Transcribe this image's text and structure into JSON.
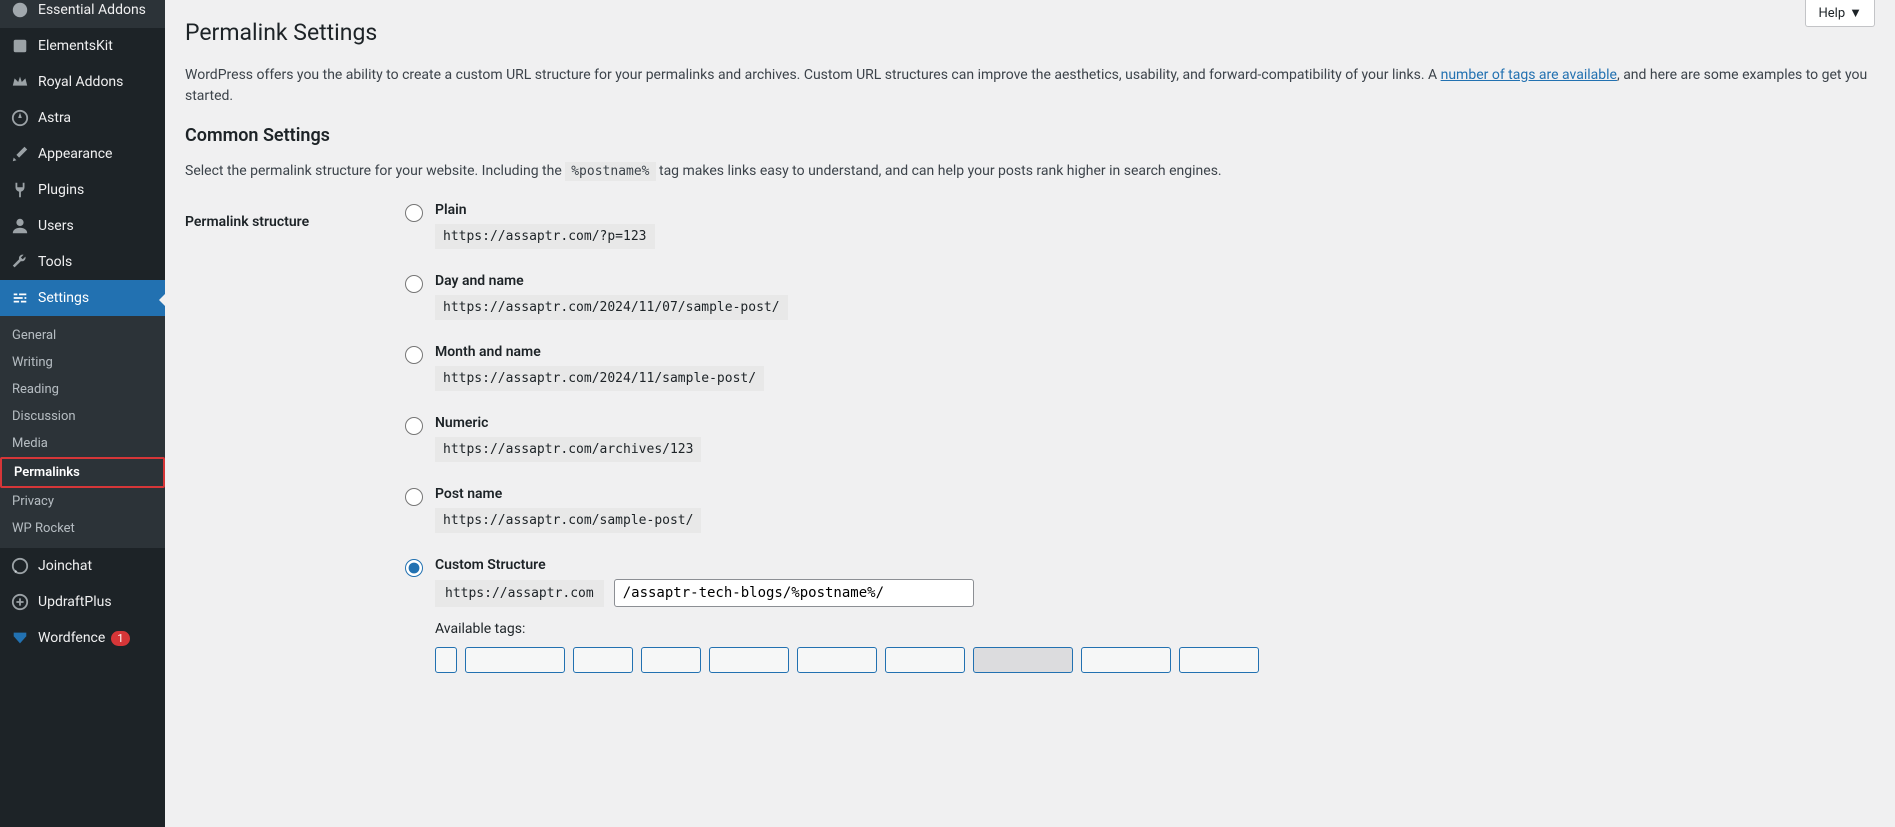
{
  "sidebar": {
    "items": [
      {
        "label": "Essential Addons",
        "icon": "plugin"
      },
      {
        "label": "ElementsKit",
        "icon": "kit"
      },
      {
        "label": "Royal Addons",
        "icon": "crown"
      },
      {
        "label": "Astra",
        "icon": "astra"
      },
      {
        "label": "Appearance",
        "icon": "brush"
      },
      {
        "label": "Plugins",
        "icon": "plug"
      },
      {
        "label": "Users",
        "icon": "user"
      },
      {
        "label": "Tools",
        "icon": "wrench"
      },
      {
        "label": "Settings",
        "icon": "sliders",
        "active": true
      }
    ],
    "submenu": [
      {
        "label": "General"
      },
      {
        "label": "Writing"
      },
      {
        "label": "Reading"
      },
      {
        "label": "Discussion"
      },
      {
        "label": "Media"
      },
      {
        "label": "Permalinks",
        "current": true
      },
      {
        "label": "Privacy"
      },
      {
        "label": "WP Rocket"
      }
    ],
    "post_items": [
      {
        "label": "Joinchat",
        "icon": "chat"
      },
      {
        "label": "UpdraftPlus",
        "icon": "updraft"
      },
      {
        "label": "Wordfence",
        "icon": "wordfence",
        "badge": "1"
      }
    ]
  },
  "help_label": "Help",
  "page_title": "Permalink Settings",
  "intro_text_1": "WordPress offers you the ability to create a custom URL structure for your permalinks and archives. Custom URL structures can improve the aesthetics, usability, and forward-compatibility of your links. A ",
  "intro_link": "number of tags are available",
  "intro_text_2": ", and here are some examples to get you started.",
  "section_title": "Common Settings",
  "select_text_1": "Select the permalink structure for your website. Including the ",
  "select_code": "%postname%",
  "select_text_2": " tag makes links easy to understand, and can help your posts rank higher in search engines.",
  "structure_label": "Permalink structure",
  "options": [
    {
      "title": "Plain",
      "example": "https://assaptr.com/?p=123",
      "checked": false
    },
    {
      "title": "Day and name",
      "example": "https://assaptr.com/2024/11/07/sample-post/",
      "checked": false
    },
    {
      "title": "Month and name",
      "example": "https://assaptr.com/2024/11/sample-post/",
      "checked": false
    },
    {
      "title": "Numeric",
      "example": "https://assaptr.com/archives/123",
      "checked": false
    },
    {
      "title": "Post name",
      "example": "https://assaptr.com/sample-post/",
      "checked": false
    },
    {
      "title": "Custom Structure",
      "checked": true
    }
  ],
  "custom_prefix": "https://assaptr.com",
  "custom_value": "/assaptr-tech-blogs/%postname%/",
  "available_tags_label": "Available tags:"
}
